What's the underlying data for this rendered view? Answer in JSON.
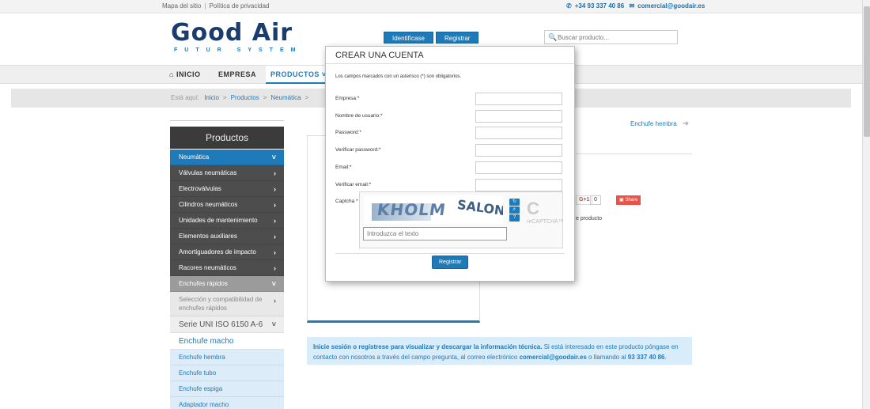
{
  "topbar": {
    "sitemap": "Mapa del sitio",
    "divider": "|",
    "privacy": "Política de privacidad",
    "phone": "+34 93 337 40 86",
    "email": "comercial@goodair.es"
  },
  "logo": {
    "word_good": "Good",
    "word_air": "Air",
    "tagline": "FUTUR SYSTEM"
  },
  "header": {
    "login_label": "Identifícase",
    "register_label": "Registrar",
    "search_placeholder": "Buscar producto..."
  },
  "nav": {
    "inicio": "INICIO",
    "empresa": "EMPRESA",
    "productos": "PRODUCTOS"
  },
  "breadcrumb": {
    "prefix": "Está aquí:",
    "items": [
      "Inicio",
      "Productos",
      "Neumática"
    ]
  },
  "sidebar": {
    "title": "Productos",
    "items": [
      "Neumática",
      "Válvulas neumáticas",
      "Electroválvulas",
      "Cilindros neumáticos",
      "Unidades de mantenimiento",
      "Elementos auxiliares",
      "Amortiguadores de impacto",
      "Racores neumáticos",
      "Enchufes rápidos",
      "Selección y compatibilidad de enchufes rápidos",
      "Serie UNI ISO 6150 A-6",
      "Enchufe macho",
      "Enchufe hembra",
      "Enchufe tubo",
      "Enchufe espiga",
      "Adaptador macho"
    ]
  },
  "content": {
    "next_link": "Enchufe hembra",
    "gplus": "G+1",
    "gplus_count": "0",
    "share": "Share",
    "product_text": "e producto"
  },
  "info": {
    "bold1": "Inicie sesión o regístrese para visualizar y descargar la información técnica.",
    "text1": " Si está interesado en este producto póngase en contacto con nosotros a través del campo pregunta, al correo electrónico ",
    "email": "comercial@goodair.es",
    "text2": " o llamando al ",
    "phone": "93 337 40 86",
    "text3": "."
  },
  "modal": {
    "title": "CREAR UNA CUENTA",
    "note": "Los campos marcados con un asterisco (*) son obligatorios.",
    "labels": {
      "empresa": "Empresa:*",
      "usuario": "Nombre de usuario:*",
      "password": "Password:*",
      "verify_password": "Verificar password:*",
      "email": "Email:*",
      "verify_email": "Verificar email:*",
      "captcha": "Captcha *"
    },
    "captcha_word1": "KHOLM",
    "captcha_word2": "SALON",
    "captcha_placeholder": "Introduzca el texto",
    "captcha_brand": "reCAPTCHA™",
    "submit_label": "Registrar"
  },
  "colors": {
    "accent": "#1e7ab8",
    "dark_menu": "#4d4d4d"
  }
}
